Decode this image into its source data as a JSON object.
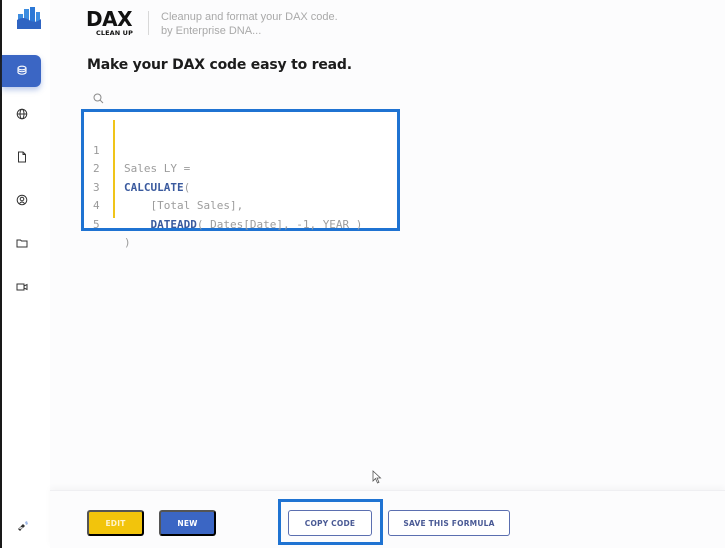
{
  "app": {
    "brand_title": "DAX",
    "brand_subtitle": "CLEAN UP",
    "tagline_line1": "Cleanup and format your DAX code.",
    "tagline_line2": "by Enterprise DNA...",
    "headline": "Make your DAX code easy to read."
  },
  "sidebar": {
    "items": [
      {
        "name": "layers",
        "icon": "layers-icon",
        "active": true
      },
      {
        "name": "globe",
        "icon": "globe-icon",
        "active": false
      },
      {
        "name": "document",
        "icon": "document-icon",
        "active": false
      },
      {
        "name": "user-circle",
        "icon": "user-circle-icon",
        "active": false
      },
      {
        "name": "folder",
        "icon": "folder-icon",
        "active": false
      },
      {
        "name": "video",
        "icon": "video-icon",
        "active": false
      }
    ],
    "bottom_icon": "brush-icon"
  },
  "search": {
    "icon": "search-icon"
  },
  "code": {
    "lines": [
      {
        "num": "1",
        "indent": "",
        "keyword": "",
        "text": "Sales LY ="
      },
      {
        "num": "2",
        "indent": "",
        "keyword": "CALCULATE",
        "text": "("
      },
      {
        "num": "3",
        "indent": "    ",
        "keyword": "",
        "text": "[Total Sales],"
      },
      {
        "num": "4",
        "indent": "    ",
        "keyword": "DATEADD",
        "text": "( Dates[Date], -1, YEAR )"
      },
      {
        "num": "5",
        "indent": "",
        "keyword": "",
        "text": ")"
      }
    ]
  },
  "footer": {
    "edit_label": "EDIT",
    "new_label": "NEW",
    "copy_label": "COPY CODE",
    "save_label": "SAVE THIS FORMULA"
  },
  "colors": {
    "accent_blue": "#3b66c4",
    "highlight_blue": "#1f73d2",
    "edit_yellow": "#f2c40c",
    "gutter_yellow": "#f0c419",
    "keyword_blue": "#3a5a9e"
  }
}
